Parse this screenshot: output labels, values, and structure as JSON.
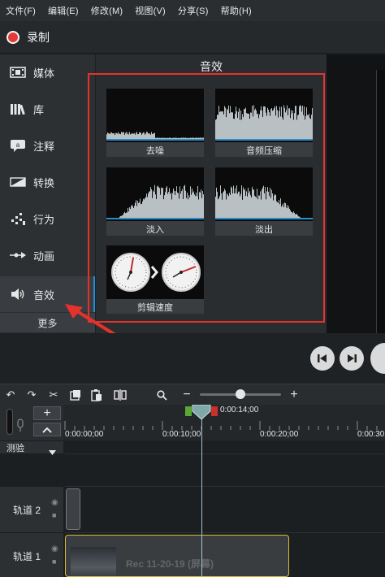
{
  "menubar": {
    "items": [
      "文件(F)",
      "编辑(E)",
      "修改(M)",
      "视图(V)",
      "分享(S)",
      "帮助(H)"
    ]
  },
  "record": {
    "label": "录制"
  },
  "sidebar": {
    "items": [
      {
        "label": "媒体",
        "icon": "film-icon"
      },
      {
        "label": "库",
        "icon": "library-icon"
      },
      {
        "label": "注释",
        "icon": "annotation-icon"
      },
      {
        "label": "转换",
        "icon": "transition-icon"
      },
      {
        "label": "行为",
        "icon": "behavior-icon"
      },
      {
        "label": "动画",
        "icon": "animation-icon"
      },
      {
        "label": "音效",
        "icon": "speaker-icon"
      }
    ],
    "active": "音效",
    "more_label": "更多"
  },
  "panel": {
    "title": "音效",
    "effects": [
      {
        "label": "去噪"
      },
      {
        "label": "音频压缩"
      },
      {
        "label": "淡入"
      },
      {
        "label": "淡出"
      },
      {
        "label": "剪辑速度"
      }
    ]
  },
  "timeline": {
    "playhead_time": "0:00:14;00",
    "ticks": [
      "0:00:00;00",
      "0:00:10;00",
      "0:00:20;00",
      "0:00:30"
    ],
    "tracks": [
      {
        "name": "测验"
      },
      {
        "name": "轨道 2"
      },
      {
        "name": "轨道 1"
      }
    ],
    "clip_label": "Rec 11-20-19 (屏幕)"
  },
  "colors": {
    "accent_blue": "#1f8fd6",
    "record_red": "#e23a3a",
    "highlight_red": "#e5322d",
    "clip_border": "#d8b93a"
  }
}
